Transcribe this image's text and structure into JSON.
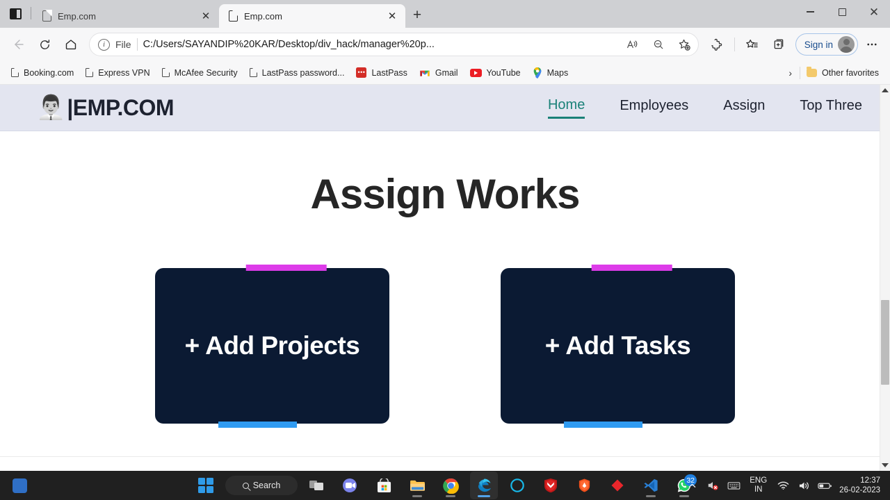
{
  "browser": {
    "tabs": [
      {
        "title": "Emp.com",
        "active": false
      },
      {
        "title": "Emp.com",
        "active": true
      }
    ],
    "new_tab_label": "+",
    "close_label": "✕",
    "window_controls": {
      "minimize": "minimize",
      "maximize": "maximize",
      "close": "close"
    },
    "nav": {
      "back": "back",
      "refresh": "refresh",
      "home": "home"
    },
    "omnibox": {
      "scheme_label": "File",
      "url": "C:/Users/SAYANDIP%20KAR/Desktop/div_hack/manager%20p...",
      "icons": [
        "read-aloud-icon",
        "zoom-out-icon",
        "add-favorite-icon"
      ]
    },
    "toolbar_icons": [
      "extensions-icon",
      "favorites-icon",
      "collections-icon",
      "settings-more-icon"
    ],
    "sign_in_label": "Sign in",
    "bookmarks": [
      {
        "label": "Booking.com",
        "icon": "page-icon"
      },
      {
        "label": "Express VPN",
        "icon": "page-icon"
      },
      {
        "label": "McAfee Security",
        "icon": "page-icon"
      },
      {
        "label": "LastPass password...",
        "icon": "page-icon"
      },
      {
        "label": "LastPass",
        "icon": "lastpass-icon"
      },
      {
        "label": "Gmail",
        "icon": "gmail-icon"
      },
      {
        "label": "YouTube",
        "icon": "youtube-icon"
      },
      {
        "label": "Maps",
        "icon": "maps-icon"
      }
    ],
    "bookmarks_overflow": "›",
    "other_favorites": "Other favorites"
  },
  "site": {
    "logo": {
      "emoji": "👨‍💼",
      "text": "|EMP.COM"
    },
    "nav": [
      {
        "label": "Home",
        "active": true
      },
      {
        "label": "Employees",
        "active": false
      },
      {
        "label": "Assign",
        "active": false
      },
      {
        "label": "Top Three",
        "active": false
      }
    ],
    "heading": "Assign Works",
    "cards": [
      {
        "label": "+ Add Projects"
      },
      {
        "label": "+ Add Tasks"
      }
    ],
    "colors": {
      "header_bg": "#e3e5f0",
      "accent_teal": "#1a8178",
      "card_bg": "#0b1a33",
      "bar_magenta": "#dd3ce9",
      "bar_blue": "#2f9bf2",
      "heading": "#262626"
    }
  },
  "taskbar": {
    "start_label": "start-button",
    "search_label": "Search",
    "apps": [
      {
        "name": "task-view-icon",
        "open": false
      },
      {
        "name": "teams-chat-icon",
        "open": false
      },
      {
        "name": "microsoft-store-icon",
        "open": false
      },
      {
        "name": "file-explorer-icon",
        "open": true
      },
      {
        "name": "chrome-icon",
        "open": true
      },
      {
        "name": "edge-icon",
        "open": true,
        "active": true
      },
      {
        "name": "cortana-icon",
        "open": false
      },
      {
        "name": "mcafee-icon",
        "open": false
      },
      {
        "name": "brave-icon",
        "open": false
      },
      {
        "name": "red-diamond-icon",
        "open": false
      },
      {
        "name": "vscode-icon",
        "open": true
      },
      {
        "name": "whatsapp-icon",
        "open": true,
        "badge": "32"
      }
    ],
    "tray": {
      "overflow": "⌃",
      "icons": [
        "mic-muted-icon",
        "keyboard-icon",
        "wifi-icon",
        "volume-icon",
        "battery-icon"
      ],
      "language": {
        "line1": "ENG",
        "line2": "IN"
      },
      "time": "12:37",
      "date": "26-02-2023"
    }
  }
}
